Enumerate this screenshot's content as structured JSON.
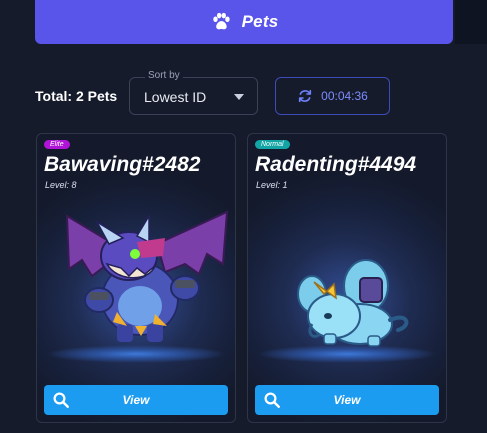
{
  "header": {
    "title": "Pets",
    "icon": "paw-icon"
  },
  "toolbar": {
    "total_label": "Total: 2 Pets",
    "sort": {
      "label": "Sort by",
      "value": "Lowest ID"
    },
    "timer": "00:04:36"
  },
  "pets": [
    {
      "rarity": "Elite",
      "name": "Bawaving#2482",
      "level": "Level: 8",
      "view_label": "View"
    },
    {
      "rarity": "Normal",
      "name": "Radenting#4494",
      "level": "Level: 1",
      "view_label": "View"
    }
  ],
  "colors": {
    "accent": "#5a55ea",
    "button": "#1b9cf0",
    "elite": "#b014d6",
    "normal": "#13a5a5"
  }
}
